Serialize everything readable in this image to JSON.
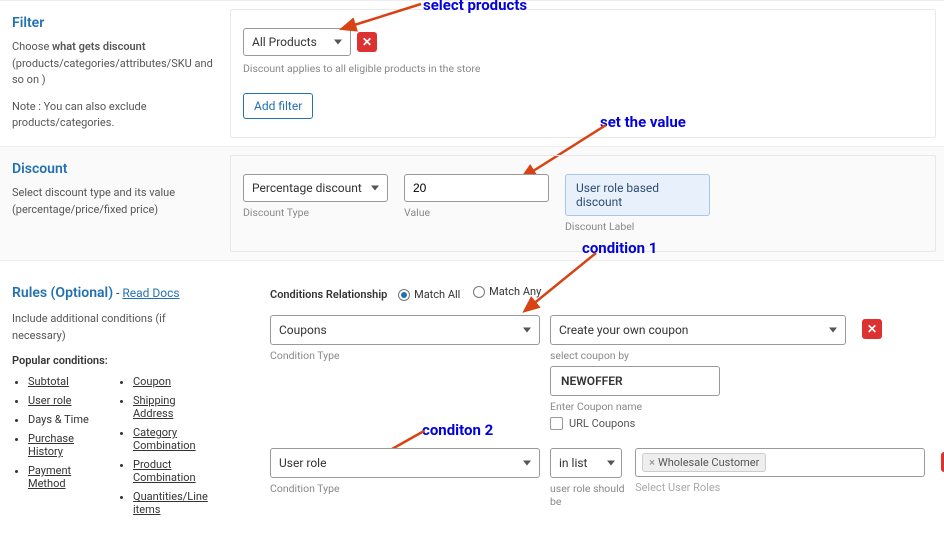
{
  "filter": {
    "title": "Filter",
    "desc_lead": "Choose ",
    "desc_bold": "what gets discount",
    "desc_tail": " (products/categories/attributes/SKU and so on )",
    "note": "Note : You can also exclude products/categories.",
    "select_value": "All Products",
    "hint": "Discount applies to all eligible products in the store",
    "add_filter": "Add filter"
  },
  "discount": {
    "title": "Discount",
    "desc": "Select discount type and its value (percentage/price/fixed price)",
    "type_value": "Percentage discount",
    "type_label": "Discount Type",
    "value": "20",
    "value_label": "Value",
    "badge": "User role based discount",
    "badge_label": "Discount Label"
  },
  "rules": {
    "title": "Rules (Optional)",
    "read_docs": "Read Docs",
    "desc": "Include additional conditions (if necessary)",
    "popular_label": "Popular conditions:",
    "left_list": [
      "Subtotal",
      "User role",
      "Days & Time",
      "Purchase History",
      "Payment Method"
    ],
    "right_list": [
      "Coupon",
      "Shipping Address",
      "Category Combination",
      "Product Combination",
      "Quantities/Line items"
    ],
    "rel_label": "Conditions Relationship",
    "match_all": "Match All",
    "match_any": "Match Any",
    "cond1": {
      "type": "Coupons",
      "type_label": "Condition Type",
      "coupon_mode": "Create your own coupon",
      "coupon_mode_label": "select coupon by",
      "coupon_code": "NEWOFFER",
      "coupon_code_label": "Enter Coupon name",
      "url_coupons": "URL Coupons"
    },
    "cond2": {
      "type": "User role",
      "type_label": "Condition Type",
      "op": "in list",
      "op_label": "user role should be",
      "token": "Wholesale Customer",
      "placeholder": "Select User Roles"
    }
  },
  "annotations": {
    "a1": "select products",
    "a2": "set the value",
    "a3": "condition 1",
    "a4": "conditon 2"
  }
}
